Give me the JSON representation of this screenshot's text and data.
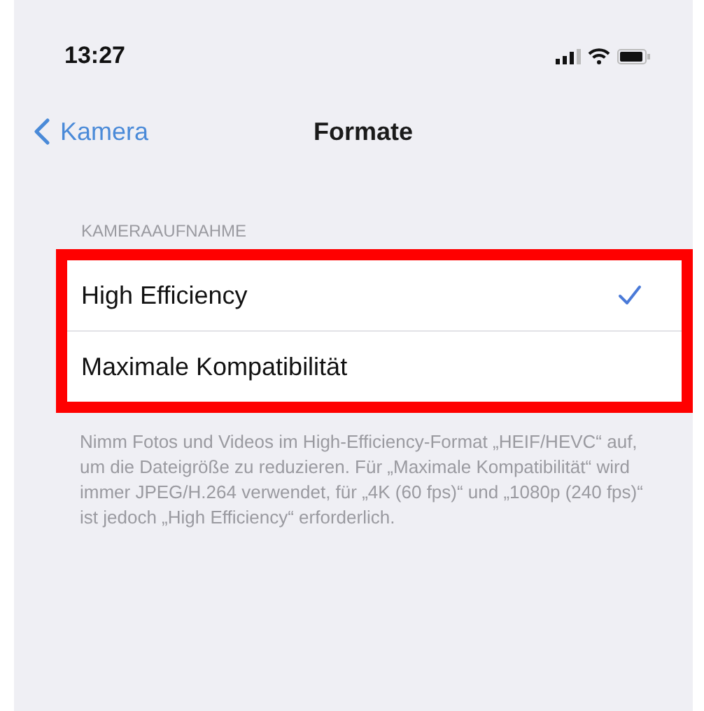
{
  "status_bar": {
    "time": "13:27"
  },
  "nav": {
    "back": "Kamera",
    "title": "Formate"
  },
  "section": {
    "header": "KAMERAAUFNAHME",
    "highlighted": true,
    "options": [
      {
        "label": "High Efficiency",
        "selected": true
      },
      {
        "label": "Maximale Kompatibilität",
        "selected": false
      }
    ],
    "footer": "Nimm Fotos und Videos im High-Efficiency-Format „HEIF/HEVC“ auf, um die Dateigröße zu reduzieren. Für „Maximale Kompatibilität“ wird immer JPEG/H.264 verwendet, für „4K (60 fps)“ und „1080p (240 fps)“ ist jedoch „High Efficiency“ erforderlich."
  }
}
